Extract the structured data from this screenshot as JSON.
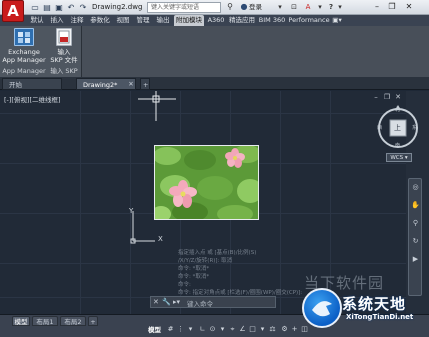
{
  "titlebar": {
    "doc_title": "Drawing2.dwg",
    "search_placeholder": "键入关键字或短语",
    "login_label": "登录",
    "help_label": "?"
  },
  "menu_tabs": [
    {
      "label": "默认",
      "active": false
    },
    {
      "label": "插入",
      "active": false
    },
    {
      "label": "注释",
      "active": false
    },
    {
      "label": "参数化",
      "active": false
    },
    {
      "label": "视图",
      "active": false
    },
    {
      "label": "管理",
      "active": false
    },
    {
      "label": "输出",
      "active": false
    },
    {
      "label": "附加模块",
      "active": true
    },
    {
      "label": "A360",
      "active": false
    },
    {
      "label": "精选应用",
      "active": false
    },
    {
      "label": "BIM 360",
      "active": false
    },
    {
      "label": "Performance",
      "active": false
    }
  ],
  "ribbon": {
    "exchange_line1": "Exchange",
    "exchange_line2": "App Manager",
    "import_line1": "输入",
    "import_line2": "SKP 文件",
    "panel_left_label": "App Manager",
    "panel_right_label": "输入 SKP"
  },
  "file_tabs": [
    {
      "label": "开始",
      "active": false
    },
    {
      "label": "Drawing2*",
      "active": true
    },
    {
      "label": "+",
      "active": false
    }
  ],
  "viewport_label": "[-][俯视][二维线框]",
  "navcube": {
    "face": "上",
    "n": "北",
    "s": "南",
    "e": "东",
    "w": "西",
    "wcs": "WCS ▾"
  },
  "ucs": {
    "x_label": "X",
    "y_label": "Y"
  },
  "command_history": [
    "指定插入点 或 [基点(B)/比例(S)",
    "/X/Y/Z/旋转(R)]: 取消",
    "命令: *取消*",
    "命令: *取消*",
    "命令:",
    "命令: 指定对角点或 [栏选(F)/圈围(WP)/圈交(CP)]:"
  ],
  "command_input_placeholder": "键入命令",
  "layout_tabs": [
    {
      "label": "模型",
      "active": true
    },
    {
      "label": "布局1",
      "active": false
    },
    {
      "label": "布局2",
      "active": false
    },
    {
      "label": "+",
      "active": false
    }
  ],
  "status": {
    "model_label": "模型"
  },
  "watermark": {
    "top_text": "当下软件园",
    "main_text": "系统天地",
    "url_text": "XiTongTianDi.net"
  },
  "colors": {
    "accent": "#c91c1c",
    "active_tab": "#c8ccd2",
    "canvas": "#212a37"
  }
}
